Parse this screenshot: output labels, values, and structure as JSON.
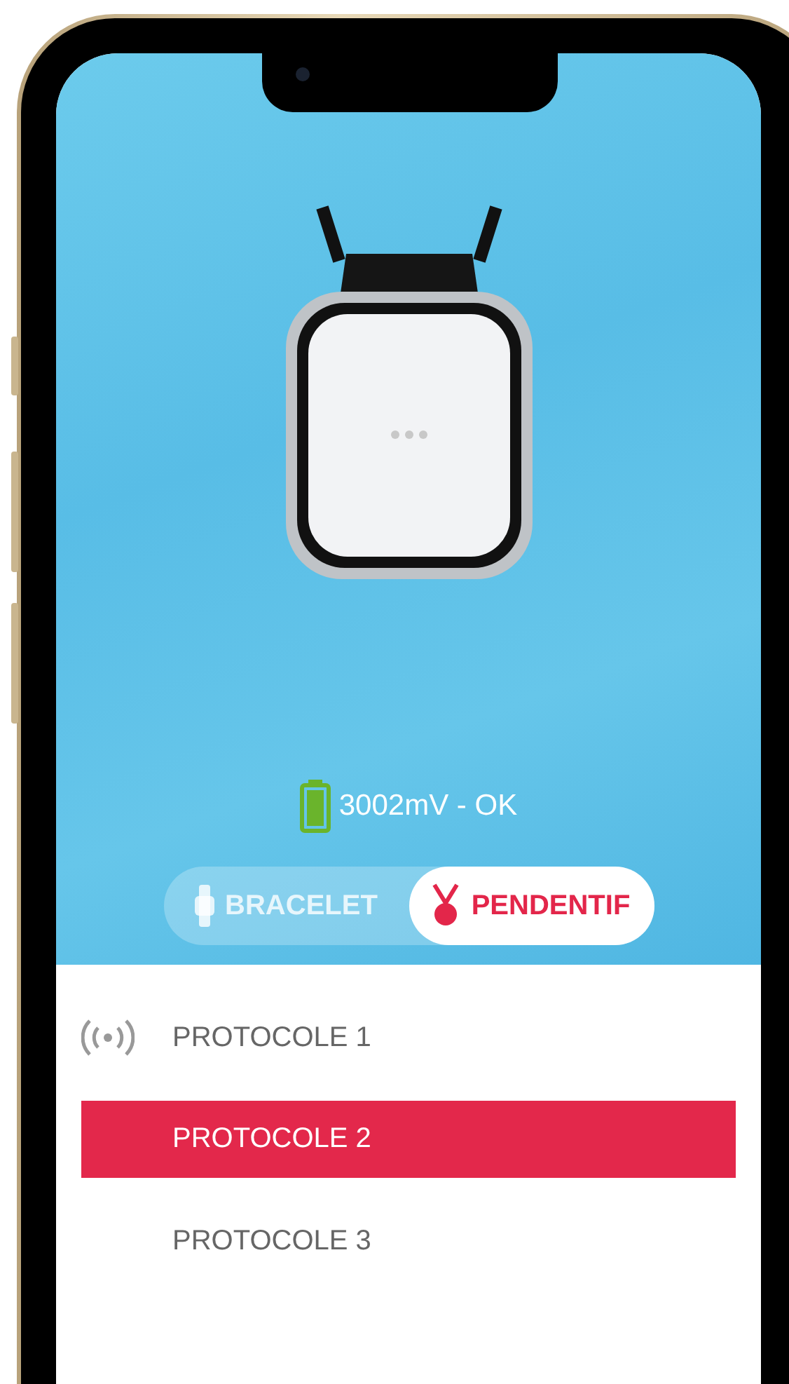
{
  "battery": {
    "reading": "3002mV - OK"
  },
  "device_toggle": [
    {
      "label": "BRACELET",
      "kind": "bracelet",
      "selected": false
    },
    {
      "label": "PENDENTIF",
      "kind": "pendant",
      "selected": true
    }
  ],
  "protocols": [
    {
      "label": "PROTOCOLE 1",
      "connected": true,
      "selected": false
    },
    {
      "label": "PROTOCOLE 2",
      "connected": false,
      "selected": true
    },
    {
      "label": "PROTOCOLE 3",
      "connected": false,
      "selected": false
    }
  ]
}
